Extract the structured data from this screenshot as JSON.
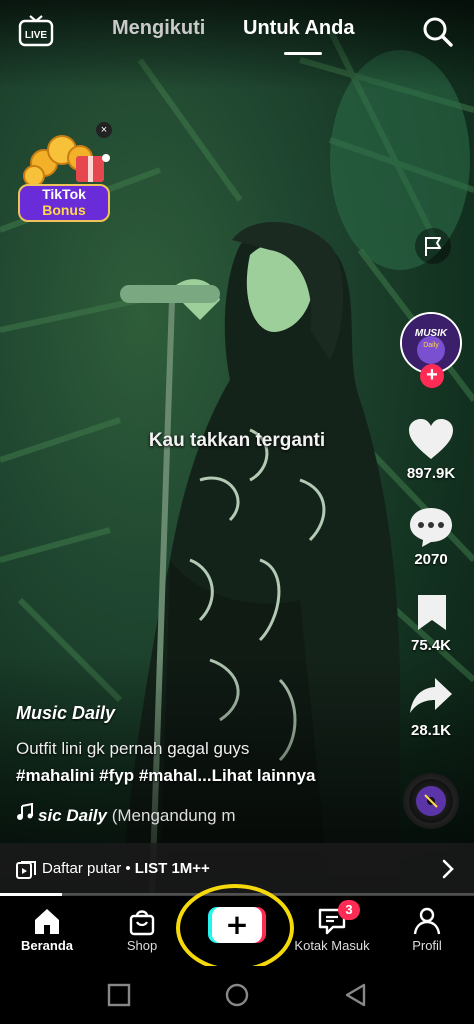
{
  "top": {
    "live_label": "LIVE",
    "tabs": [
      {
        "label": "Mengikuti",
        "active": false
      },
      {
        "label": "Untuk Anda",
        "active": true
      }
    ]
  },
  "bonus": {
    "line1": "TikTok",
    "line2": "Bonus",
    "close": "×"
  },
  "video": {
    "lyric": "Kau takkan terganti"
  },
  "rail": {
    "avatar_text_line1": "MUSIK",
    "avatar_text_line2": "Daily",
    "follow": "+",
    "likes": "897.9K",
    "comments": "2070",
    "saves": "75.4K",
    "shares": "28.1K"
  },
  "caption": {
    "author": "Music Daily",
    "description": "Outfit lini gk pernah gagal guys",
    "hashtags": "#mahalini #fyp #mahal...",
    "see_more": "Lihat lainnya",
    "sound_name": "sic Daily",
    "sound_extra": " (Mengandung m"
  },
  "playlist": {
    "prefix": "Daftar putar • ",
    "name": "LIST 1M++",
    "progress": 0.13
  },
  "nav": {
    "home": "Beranda",
    "shop": "Shop",
    "create": "+",
    "inbox": "Kotak Masuk",
    "inbox_badge": "3",
    "profile": "Profil"
  },
  "colors": {
    "accent": "#fe2c55",
    "highlight_ring": "#f5d90a",
    "cyan": "#25f4ee"
  }
}
